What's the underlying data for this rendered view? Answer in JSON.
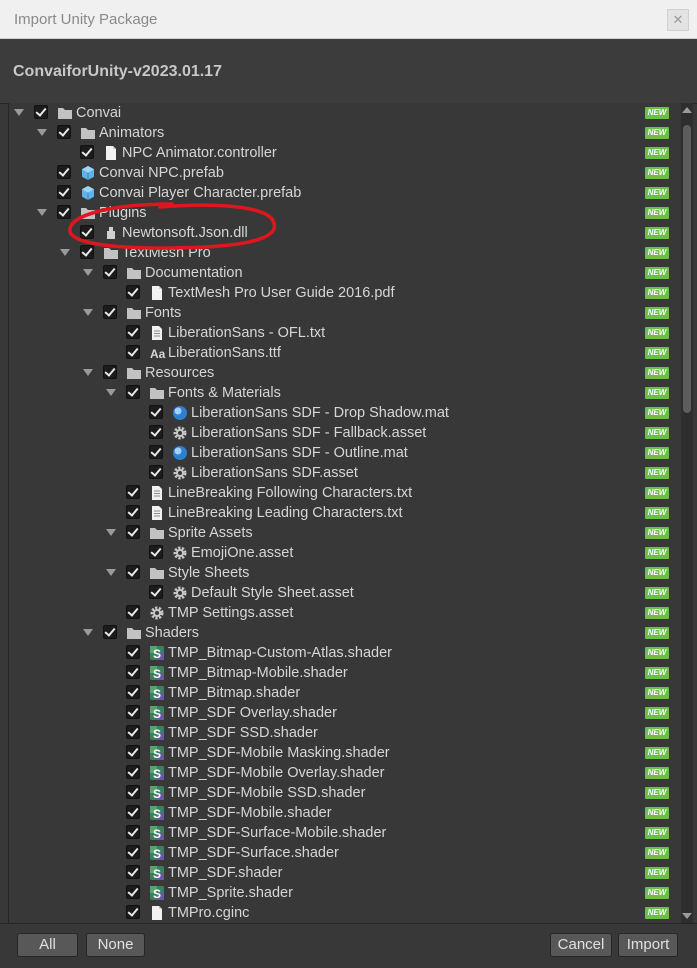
{
  "window": {
    "title": "Import Unity Package",
    "close_glyph": "✕"
  },
  "package": {
    "name": "ConvaiforUnity-v2023.01.17"
  },
  "new_badge": "NEW",
  "tree": [
    {
      "label": "Convai",
      "icon": "folder-icon",
      "depth": 0,
      "fold": true
    },
    {
      "label": "Animators",
      "icon": "folder-icon",
      "depth": 1,
      "fold": true
    },
    {
      "label": "NPC Animator.controller",
      "icon": "file-icon",
      "depth": 2,
      "fold": false
    },
    {
      "label": "Convai NPC.prefab",
      "icon": "prefab-icon",
      "depth": 1,
      "fold": false
    },
    {
      "label": "Convai Player Character.prefab",
      "icon": "prefab-icon",
      "depth": 1,
      "fold": false
    },
    {
      "label": "Plugins",
      "icon": "folder-icon",
      "depth": 1,
      "fold": true
    },
    {
      "label": "Newtonsoft.Json.dll",
      "icon": "dll-icon",
      "depth": 2,
      "fold": false
    },
    {
      "label": "TextMesh Pro",
      "icon": "folder-icon",
      "depth": 2,
      "fold": true
    },
    {
      "label": "Documentation",
      "icon": "folder-icon",
      "depth": 3,
      "fold": true
    },
    {
      "label": "TextMesh Pro User Guide 2016.pdf",
      "icon": "file-icon",
      "depth": 4,
      "fold": false
    },
    {
      "label": "Fonts",
      "icon": "folder-icon",
      "depth": 3,
      "fold": true
    },
    {
      "label": "LiberationSans - OFL.txt",
      "icon": "text-file-icon",
      "depth": 4,
      "fold": false
    },
    {
      "label": "LiberationSans.ttf",
      "icon": "font-icon",
      "depth": 4,
      "fold": false
    },
    {
      "label": "Resources",
      "icon": "folder-icon",
      "depth": 3,
      "fold": true
    },
    {
      "label": "Fonts & Materials",
      "icon": "folder-icon",
      "depth": 4,
      "fold": true
    },
    {
      "label": "LiberationSans SDF - Drop Shadow.mat",
      "icon": "material-icon",
      "depth": 5,
      "fold": false
    },
    {
      "label": "LiberationSans SDF - Fallback.asset",
      "icon": "asset-gear-icon",
      "depth": 5,
      "fold": false
    },
    {
      "label": "LiberationSans SDF - Outline.mat",
      "icon": "material-icon",
      "depth": 5,
      "fold": false
    },
    {
      "label": "LiberationSans SDF.asset",
      "icon": "asset-gear-icon",
      "depth": 5,
      "fold": false
    },
    {
      "label": "LineBreaking Following Characters.txt",
      "icon": "text-file-icon",
      "depth": 4,
      "fold": false
    },
    {
      "label": "LineBreaking Leading Characters.txt",
      "icon": "text-file-icon",
      "depth": 4,
      "fold": false
    },
    {
      "label": "Sprite Assets",
      "icon": "folder-icon",
      "depth": 4,
      "fold": true
    },
    {
      "label": "EmojiOne.asset",
      "icon": "asset-gear-icon",
      "depth": 5,
      "fold": false
    },
    {
      "label": "Style Sheets",
      "icon": "folder-icon",
      "depth": 4,
      "fold": true
    },
    {
      "label": "Default Style Sheet.asset",
      "icon": "asset-gear-icon",
      "depth": 5,
      "fold": false
    },
    {
      "label": "TMP Settings.asset",
      "icon": "asset-gear-icon",
      "depth": 4,
      "fold": false
    },
    {
      "label": "Shaders",
      "icon": "folder-icon",
      "depth": 3,
      "fold": true
    },
    {
      "label": "TMP_Bitmap-Custom-Atlas.shader",
      "icon": "shader-icon",
      "depth": 4,
      "fold": false
    },
    {
      "label": "TMP_Bitmap-Mobile.shader",
      "icon": "shader-icon",
      "depth": 4,
      "fold": false
    },
    {
      "label": "TMP_Bitmap.shader",
      "icon": "shader-icon",
      "depth": 4,
      "fold": false
    },
    {
      "label": "TMP_SDF Overlay.shader",
      "icon": "shader-icon",
      "depth": 4,
      "fold": false
    },
    {
      "label": "TMP_SDF SSD.shader",
      "icon": "shader-icon",
      "depth": 4,
      "fold": false
    },
    {
      "label": "TMP_SDF-Mobile Masking.shader",
      "icon": "shader-icon",
      "depth": 4,
      "fold": false
    },
    {
      "label": "TMP_SDF-Mobile Overlay.shader",
      "icon": "shader-icon",
      "depth": 4,
      "fold": false
    },
    {
      "label": "TMP_SDF-Mobile SSD.shader",
      "icon": "shader-icon",
      "depth": 4,
      "fold": false
    },
    {
      "label": "TMP_SDF-Mobile.shader",
      "icon": "shader-icon",
      "depth": 4,
      "fold": false
    },
    {
      "label": "TMP_SDF-Surface-Mobile.shader",
      "icon": "shader-icon",
      "depth": 4,
      "fold": false
    },
    {
      "label": "TMP_SDF-Surface.shader",
      "icon": "shader-icon",
      "depth": 4,
      "fold": false
    },
    {
      "label": "TMP_SDF.shader",
      "icon": "shader-icon",
      "depth": 4,
      "fold": false
    },
    {
      "label": "TMP_Sprite.shader",
      "icon": "shader-icon",
      "depth": 4,
      "fold": false
    },
    {
      "label": "TMPro.cginc",
      "icon": "file-icon",
      "depth": 4,
      "fold": false
    }
  ],
  "footer": {
    "all_label": "All",
    "none_label": "None",
    "cancel_label": "Cancel",
    "import_label": "Import"
  },
  "colors": {
    "new_badge": "#6cc04a",
    "annotation": "#e0161e",
    "prefab": "#5fb3e8"
  }
}
